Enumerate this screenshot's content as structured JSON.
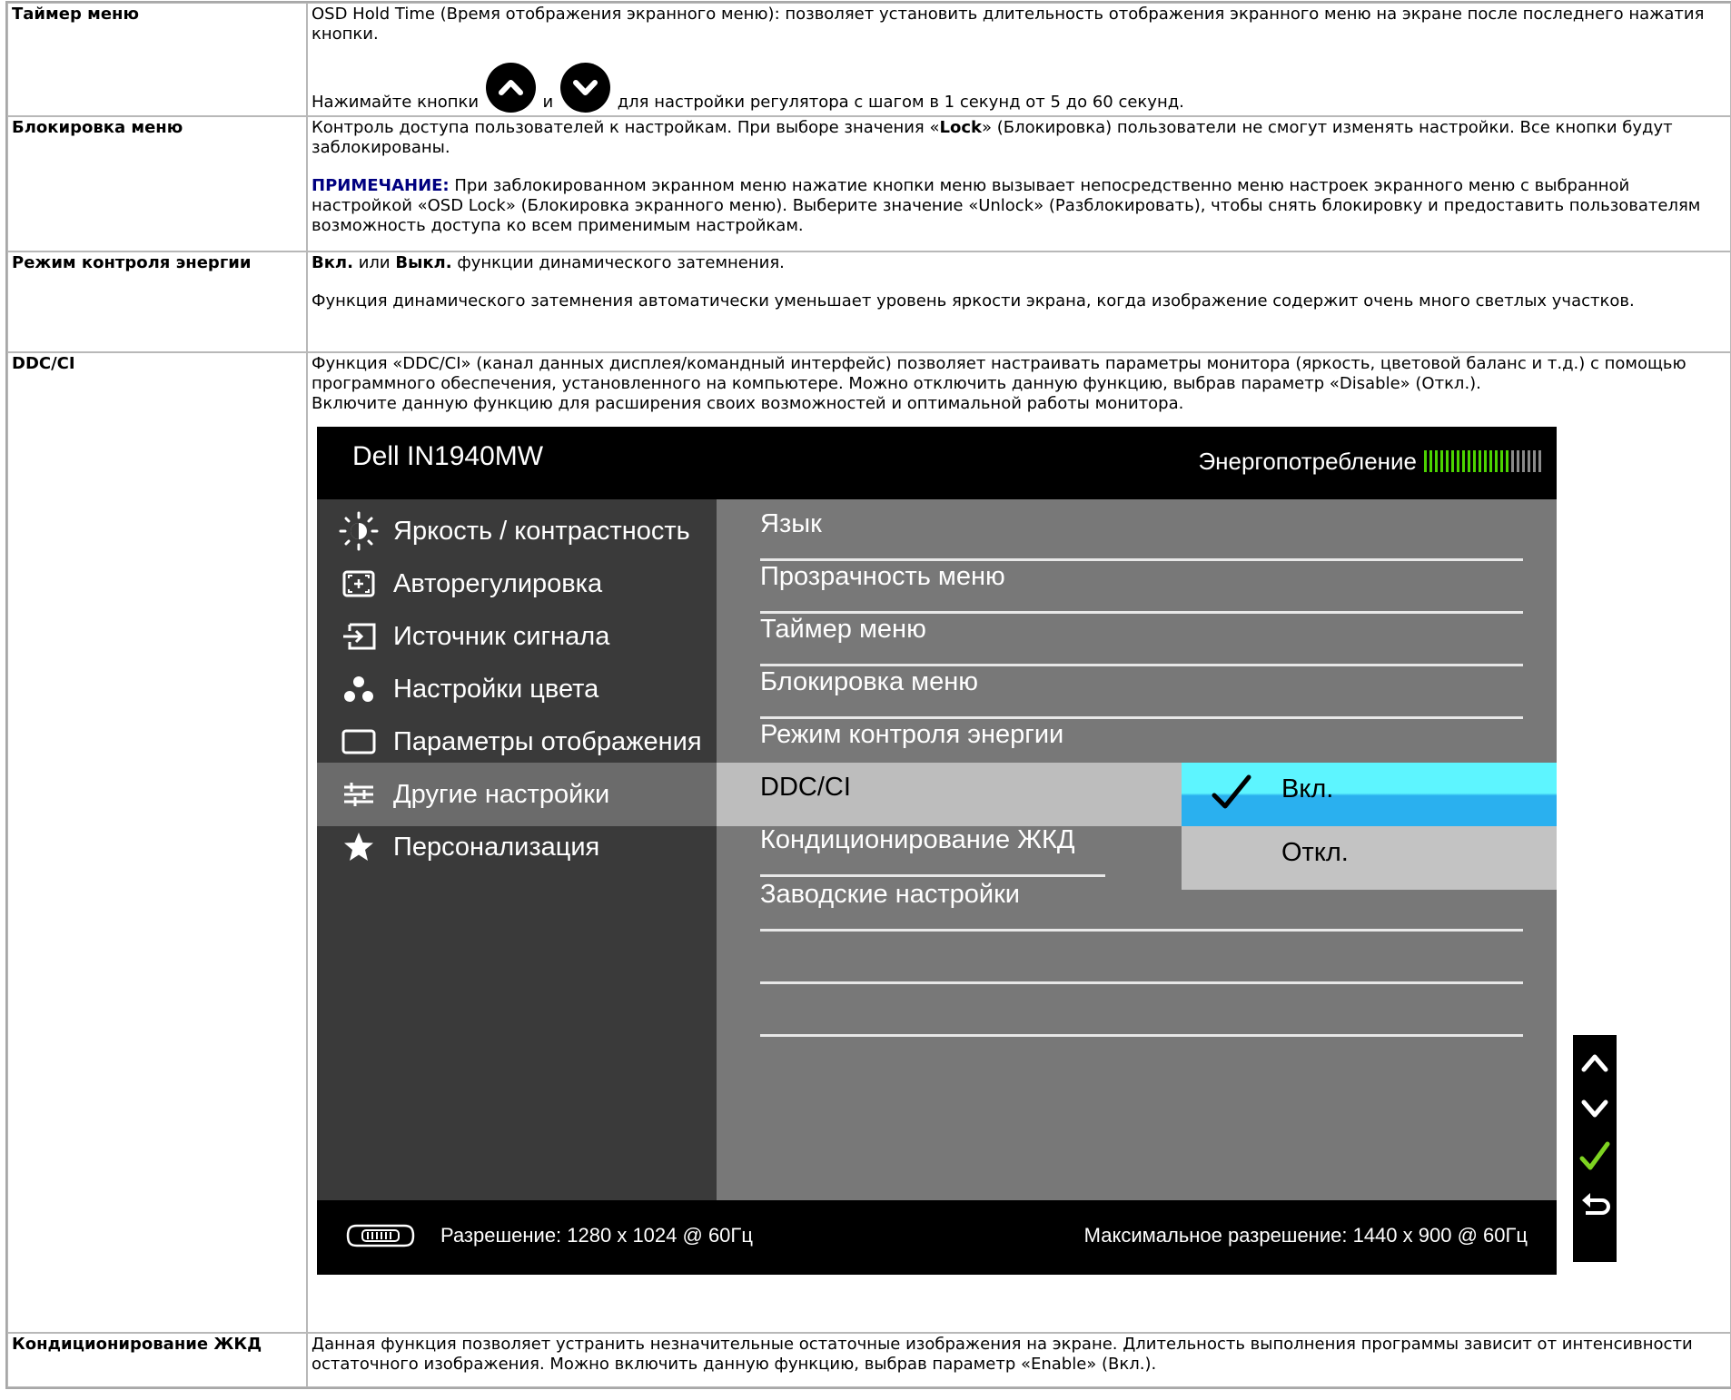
{
  "rows": {
    "timer": {
      "label": "Таймер меню",
      "p1": "OSD Hold Time (Время отображения экранного меню): позволяет установить длительность отображения экранного меню на экране после последнего нажатия кнопки.",
      "p2_before": "Нажимайте кнопки",
      "p2_and": "и",
      "p2_after": "для настройки регулятора с шагом в 1 секунд от 5 до 60 секунд."
    },
    "lock": {
      "label": "Блокировка меню",
      "p1_before": "Контроль доступа пользователей к настройкам. При выборе значения «",
      "p1_bold": "Lock",
      "p1_after": "» (Блокировка) пользователи не смогут изменять настройки. Все кнопки будут заблокированы.",
      "note_label": "ПРИМЕЧАНИЕ:",
      "note_text": "При заблокированном экранном меню нажатие кнопки меню вызывает непосредственно меню настроек экранного меню с выбранной настройкой «OSD Lock» (Блокировка экранного меню). Выберите значение «Unlock» (Разблокировать), чтобы снять блокировку и предоставить пользователям возможность доступа ко всем применимым настройкам."
    },
    "energy": {
      "label": "Режим контроля энергии",
      "on_bold": "Вкл.",
      "or": "или",
      "off_bold": "Выкл.",
      "p1_after": "функции динамического затемнения.",
      "p2": "Функция динамического затемнения автоматически уменьшает уровень яркости экрана, когда изображение содержит очень много светлых участков."
    },
    "ddc": {
      "label": "DDC/CI",
      "p1": "Функция «DDC/CI» (канал данных дисплея/командный интерфейс) позволяет настраивать параметры монитора (яркость, цветовой баланс и т.д.) с помощью программного обеспечения, установленного на компьютере. Можно отключить данную функцию, выбрав параметр «Disable» (Откл.).",
      "p2": "Включите данную функцию для расширения своих возможностей и оптимальной работы монитора."
    },
    "lcd": {
      "label": "Кондиционирование ЖКД",
      "p1": "Данная функция позволяет устранить незначительные остаточные изображения на экране. Длительность выполнения программы зависит от интенсивности остаточного изображения. Можно включить данную функцию, выбрав параметр «Enable» (Вкл.)."
    }
  },
  "osd": {
    "title": "Dell IN1940MW",
    "energy_label": "Энергопотребление",
    "energy_level_filled": 16,
    "energy_level_total": 22,
    "menu": [
      {
        "label": "Яркость / контрастность",
        "icon": "brightness-icon"
      },
      {
        "label": "Авторегулировка",
        "icon": "auto-adjust-icon"
      },
      {
        "label": "Источник сигнала",
        "icon": "input-source-icon"
      },
      {
        "label": "Настройки цвета",
        "icon": "color-settings-icon"
      },
      {
        "label": "Параметры отображения",
        "icon": "display-settings-icon"
      },
      {
        "label": "Другие настройки",
        "icon": "other-settings-icon"
      },
      {
        "label": "Персонализация",
        "icon": "star-icon"
      }
    ],
    "submenu": [
      "Язык",
      "Прозрачность меню",
      "Таймер меню",
      "Блокировка меню",
      "Режим контроля энергии",
      "DDC/CI",
      "Кондиционирование ЖКД",
      "Заводские настройки"
    ],
    "options": {
      "on": "Вкл.",
      "off": "Откл."
    },
    "footer": {
      "resolution": "Разрешение: 1280 x 1024 @ 60Гц",
      "max_resolution": "Максимальное разрешение: 1440 x 900 @ 60Гц"
    },
    "colors": {
      "energy_green": "#4cd400",
      "selected_cyan": "#5df5ff",
      "selected_blue": "#2ab0ef",
      "check_green": "#7ed321"
    }
  }
}
